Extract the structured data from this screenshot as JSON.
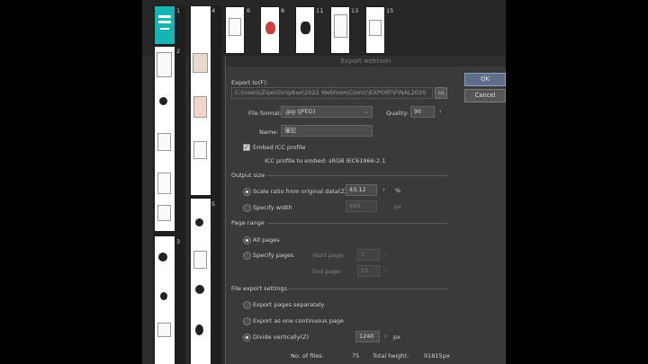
{
  "dialog": {
    "title": "Export webtoon",
    "export_to_label": "Export to(F):",
    "export_path": "C:\\Users\\Zipei\\Dropbox\\2022 Webtoon\\Comic\\EXPORT\\FINAL2026",
    "file_format_label": "File format:",
    "file_format_value": ".jpg (JPEG)",
    "quality_label": "Quality:",
    "quality_value": "90",
    "name_label": "Name:",
    "name_value": "漫記",
    "embed_icc_label": "Embed ICC profile",
    "embed_icc_checked": true,
    "icc_profile_text": "ICC profile to embed:  sRGB IEC61966-2.1",
    "output_size_section": "Output size",
    "scale_ratio_label": "Scale ratio from original data(Z)",
    "scale_ratio_value": "43.12",
    "scale_ratio_unit": "%",
    "specify_width_label": "Specify width",
    "specify_width_value": "690",
    "specify_width_unit": "px",
    "page_range_section": "Page range",
    "all_pages_label": "All pages",
    "specify_pages_label": "Specify pages",
    "start_page_label": "Start page:",
    "start_page_value": "1",
    "end_page_label": "End page:",
    "end_page_value": "15",
    "file_export_section": "File export settings",
    "export_separately_label": "Export pages separately",
    "export_continuous_label": "Export as one continuous page",
    "divide_vertically_label": "Divide vertically(Z)",
    "divide_value": "1240",
    "divide_unit": "px",
    "num_files_label": "No. of files:",
    "num_files_value": "75",
    "total_height_label": "Total height:",
    "total_height_value": "91815",
    "total_height_unit": "px",
    "ok_label": "OK",
    "cancel_label": "Cancel"
  },
  "pages": {
    "numbers": [
      "1",
      "2",
      "3",
      "4",
      "5",
      "6",
      "8",
      "11",
      "13",
      "15"
    ]
  },
  "colors": {
    "ok_button": "#5e6e88",
    "dialog_bg": "#3a3a3a",
    "cover_teal": "#18b3b3"
  }
}
